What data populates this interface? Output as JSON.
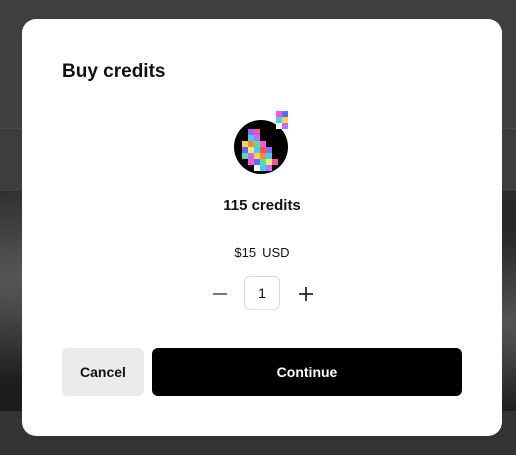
{
  "dialog": {
    "title": "Buy credits",
    "credits_label": "115 credits",
    "price": "$15",
    "currency": "USD",
    "quantity": "1",
    "cancel_label": "Cancel",
    "continue_label": "Continue"
  },
  "icons": {
    "decrement": "minus-icon",
    "increment": "plus-icon",
    "logo": "pixel-logo"
  },
  "colors": {
    "primary_button": "#000000",
    "secondary_button": "#ebebee",
    "modal_background": "#ffffff"
  }
}
